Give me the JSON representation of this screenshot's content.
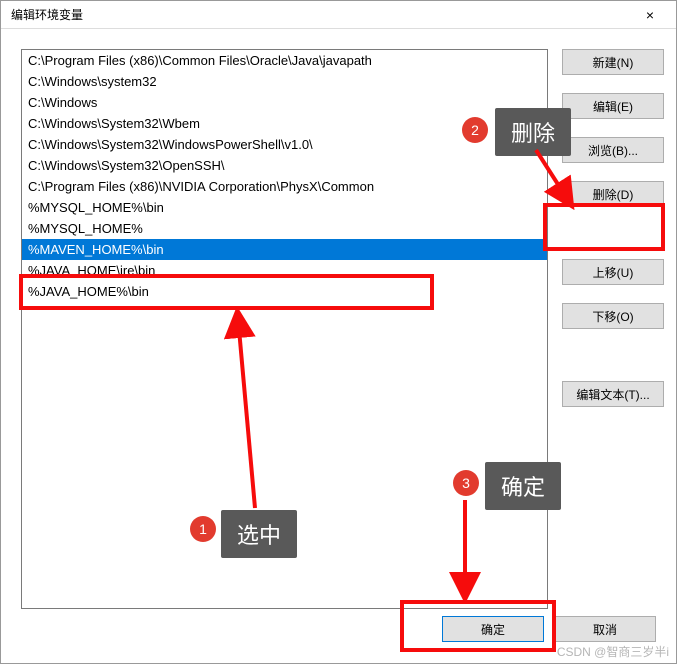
{
  "window": {
    "title": "编辑环境变量",
    "close_label": "×"
  },
  "list": {
    "items": [
      "C:\\Program Files (x86)\\Common Files\\Oracle\\Java\\javapath",
      "C:\\Windows\\system32",
      "C:\\Windows",
      "C:\\Windows\\System32\\Wbem",
      "C:\\Windows\\System32\\WindowsPowerShell\\v1.0\\",
      "C:\\Windows\\System32\\OpenSSH\\",
      "C:\\Program Files (x86)\\NVIDIA Corporation\\PhysX\\Common",
      "%MYSQL_HOME%\\bin",
      "%MYSQL_HOME%",
      "%MAVEN_HOME%\\bin",
      "%JAVA_HOME\\jre\\bin",
      "%JAVA_HOME%\\bin"
    ],
    "selected_index": 9
  },
  "buttons": {
    "new": "新建(N)",
    "edit": "编辑(E)",
    "browse": "浏览(B)...",
    "delete": "删除(D)",
    "move_up": "上移(U)",
    "move_down": "下移(O)",
    "edit_text": "编辑文本(T)...",
    "ok": "确定",
    "cancel": "取消"
  },
  "annotations": {
    "step1": {
      "num": "1",
      "label": "选中"
    },
    "step2": {
      "num": "2",
      "label": "删除"
    },
    "step3": {
      "num": "3",
      "label": "确定"
    }
  },
  "watermark": "CSDN @智商三岁半i"
}
